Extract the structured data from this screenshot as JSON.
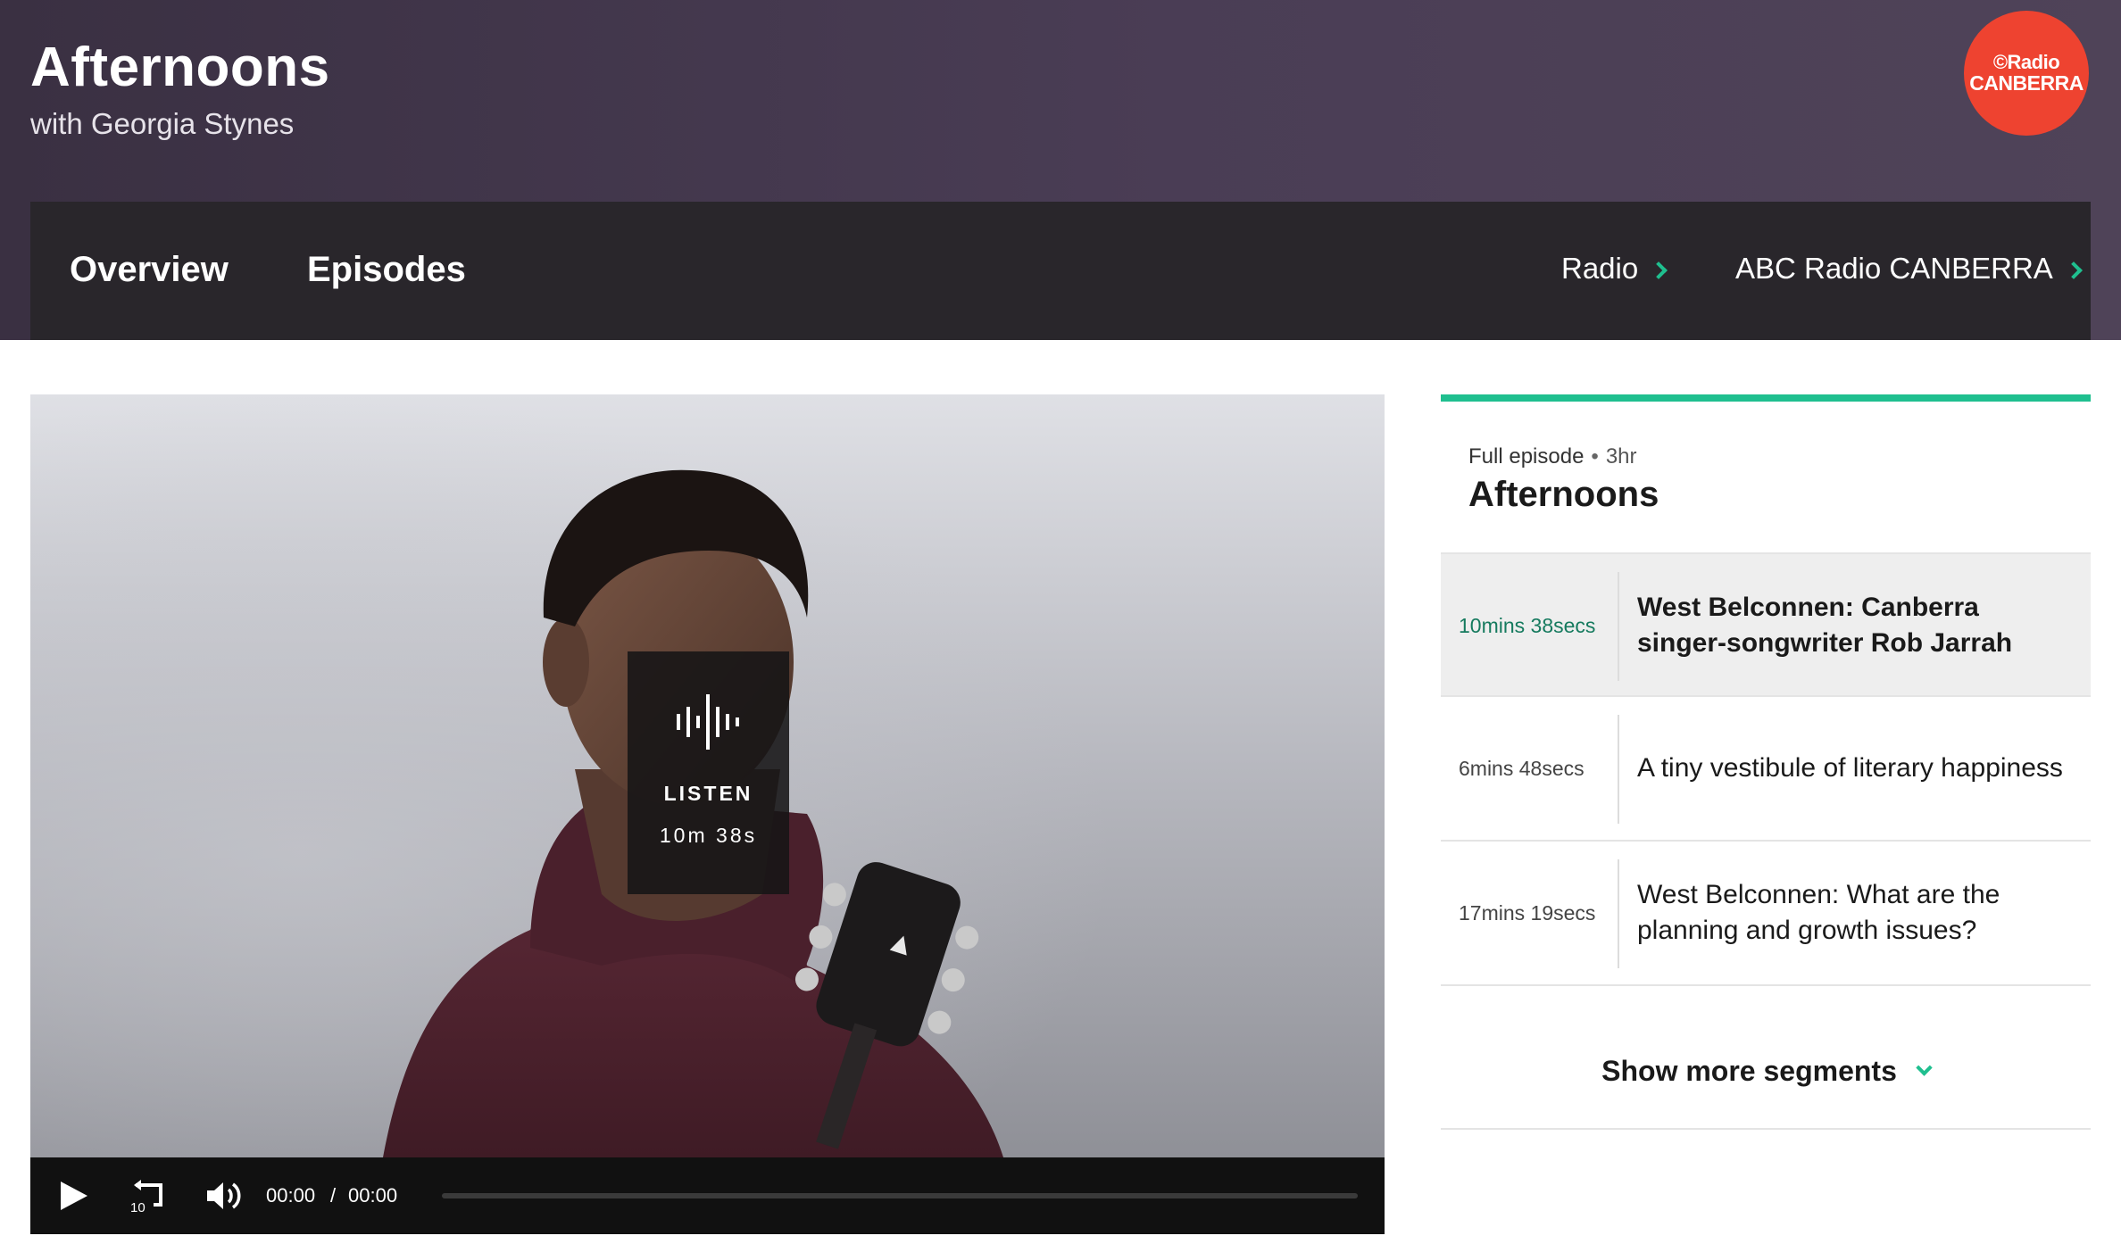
{
  "header": {
    "title": "Afternoons",
    "subtitle": "with Georgia Stynes",
    "logo_line1": "©Radio",
    "logo_line2": "CANBERRA"
  },
  "nav": {
    "tabs": [
      {
        "label": "Overview"
      },
      {
        "label": "Episodes"
      }
    ],
    "breadcrumbs": [
      {
        "label": "Radio"
      },
      {
        "label": "ABC Radio CANBERRA"
      }
    ]
  },
  "player": {
    "listen_label": "LISTEN",
    "listen_duration": "10m 38s",
    "current_time": "00:00",
    "separator": "/",
    "total_time": "00:00",
    "progress": 0,
    "icons": [
      "play-icon",
      "replay-10-icon",
      "volume-icon",
      "waveform-icon"
    ]
  },
  "episode": {
    "type": "Full episode",
    "length": "3hr",
    "title": "Afternoons",
    "segments": [
      {
        "duration": "10mins 38secs",
        "title": "West Belconnen: Canberra singer-songwriter Rob Jarrah",
        "active": true
      },
      {
        "duration": "6mins 48secs",
        "title": "A tiny vestibule of literary happiness",
        "active": false
      },
      {
        "duration": "17mins 19secs",
        "title": "West Belconnen: What are the planning and growth issues?",
        "active": false
      }
    ],
    "show_more_label": "Show more segments"
  },
  "colors": {
    "accent": "#1fbf8f",
    "logo": "#ee4330",
    "header_bg": "#433849",
    "nav_bg": "#29262b"
  }
}
